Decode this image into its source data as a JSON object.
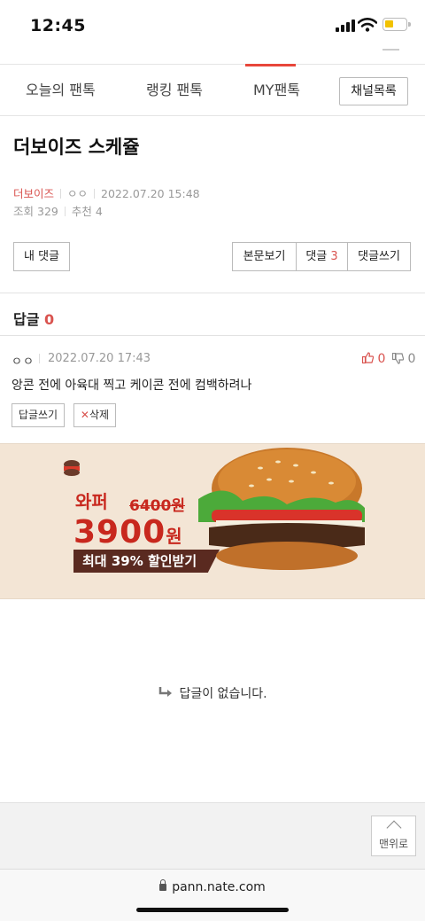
{
  "status_bar": {
    "time": "12:45"
  },
  "nav": {
    "tabs": [
      {
        "label": "오늘의 팬톡"
      },
      {
        "label": "랭킹 팬톡"
      },
      {
        "label": "MY팬톡"
      }
    ],
    "active_tab": "MY팬톡",
    "channel_button": "채널목록"
  },
  "post": {
    "title": "더보이즈 스케쥴",
    "author": "더보이즈",
    "nickname": "ㅇㅇ",
    "date": "2022.07.20 15:48",
    "views_label": "조회",
    "views": "329",
    "recommend_label": "추천",
    "recommend": "4"
  },
  "actions": {
    "my_comments": "내 댓글",
    "view_post": "본문보기",
    "comments_label": "댓글",
    "comments_count": "3",
    "write_comment": "댓글쓰기"
  },
  "replies": {
    "header_label": "답글",
    "count": "0"
  },
  "comment": {
    "author": "ㅇㅇ",
    "date": "2022.07.20 17:43",
    "text": "앙콘 전에 아육대 찍고 케이콘 전에 컴백하려나",
    "upvotes": "0",
    "downvotes": "0",
    "reply_button": "답글쓰기",
    "delete_button": "삭제"
  },
  "ad": {
    "product": "와퍼",
    "old_price": "6400원",
    "price": "3900",
    "price_unit": "원",
    "discount": "최대 39% 할인받기"
  },
  "empty_state": {
    "message": "답글이 없습니다."
  },
  "scroll_top": {
    "label": "맨위로"
  },
  "browser": {
    "url": "pann.nate.com"
  },
  "colors": {
    "accent": "#e8463a",
    "red_text": "#d9534f",
    "ad_bg": "#f3e5d5",
    "ad_red": "#c8281e"
  }
}
